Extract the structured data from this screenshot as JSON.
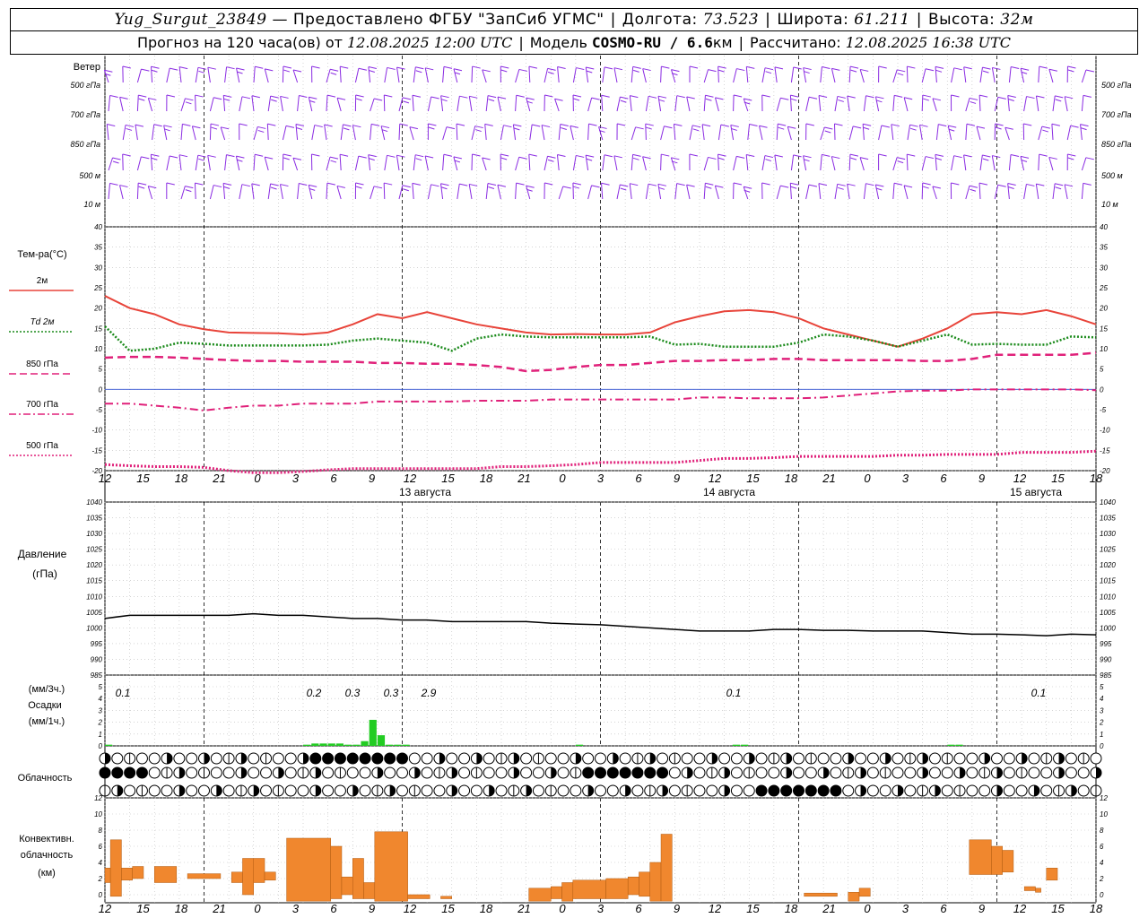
{
  "header": {
    "station": "Yug_Surgut_23849",
    "provider": "— Предоставлено ФГБУ \"ЗапСиб УГМС\"",
    "lon_label": "Долгота:",
    "lon": "73.523",
    "lat_label": "Широта:",
    "lat": "61.211",
    "alt_label": "Высота:",
    "alt": "32м",
    "forecast_prefix": "Прогноз на 120 часа(ов) от",
    "forecast_time": "12.08.2025 12:00 UTC",
    "model_label": "Модель",
    "model": "COSMO-RU / 6.6",
    "model_unit": "км",
    "computed_label": "Рассчитано:",
    "computed_time": "12.08.2025 16:38 UTC"
  },
  "colors": {
    "wind": "#8a2be2",
    "t2m": "#e8443a",
    "td2m": "#1a8a1a",
    "t850": "#e0217a",
    "t700": "#e0217a",
    "t500": "#e0217a",
    "precip": "#22cc22",
    "convective": "#f0872e"
  },
  "wind_panel": {
    "title": "Ветер",
    "levels": [
      "500 гПа",
      "700 гПа",
      "850 гПа",
      "500 м",
      "10 м"
    ]
  },
  "temp_panel": {
    "title": "Тем-ра(°С)",
    "legend": [
      {
        "label": "2м",
        "style": "solid",
        "key": "t2m"
      },
      {
        "label": "Td 2м",
        "style": "dotted",
        "key": "td2m"
      },
      {
        "label": "850 гПа",
        "style": "dash",
        "key": "t850"
      },
      {
        "label": "700 гПа",
        "style": "dashdot",
        "key": "t700"
      },
      {
        "label": "500 гПа",
        "style": "dotted",
        "key": "t500"
      }
    ],
    "ticks": [
      "40",
      "35",
      "30",
      "25",
      "20",
      "15",
      "10",
      "5",
      "0",
      "-5",
      "-10",
      "-15",
      "-20"
    ]
  },
  "x_axis": {
    "hour_labels": [
      "12",
      "15",
      "18",
      "21",
      "0",
      "3",
      "6",
      "9",
      "12",
      "15",
      "18",
      "21",
      "0",
      "3",
      "6",
      "9",
      "12",
      "15",
      "18",
      "21",
      "0",
      "3",
      "6",
      "9",
      "12",
      "15",
      "18"
    ],
    "day_labels": [
      "13 августа",
      "14 августа",
      "15 августа"
    ]
  },
  "pressure_panel": {
    "title": "Давление",
    "unit": "(гПа)",
    "ticks": [
      "1040",
      "1035",
      "1030",
      "1025",
      "1020",
      "1015",
      "1010",
      "1005",
      "1000",
      "995",
      "990",
      "985"
    ]
  },
  "precip_panel": {
    "unit_top": "(мм/3ч.)",
    "title": "Осадки",
    "unit_bottom": "(мм/1ч.)",
    "ticks": [
      "5",
      "4",
      "3",
      "2",
      "1",
      "0"
    ],
    "totals": [
      "0.1",
      "0.2",
      "0.3",
      "0.3",
      "2.9",
      "0.1",
      "0.1"
    ]
  },
  "cloud_panel": {
    "title": "Облачность"
  },
  "conv_panel": {
    "title1": "Конвективн.",
    "title2": "облачность",
    "unit": "(км)",
    "ticks": [
      "12",
      "10",
      "8",
      "6",
      "4",
      "2",
      "0"
    ]
  },
  "chart_data": [
    {
      "type": "line",
      "name": "temperature",
      "ylabel": "Тем-ра(°С)",
      "ylim": [
        -20,
        40
      ],
      "x_hours_from_start": [
        0,
        3,
        6,
        9,
        12,
        15,
        18,
        21,
        24,
        27,
        30,
        33,
        36,
        39,
        42,
        45,
        48,
        51,
        54,
        57,
        60,
        63,
        66,
        69,
        72,
        75,
        78,
        81,
        84,
        87,
        90,
        93,
        96,
        99,
        102,
        105,
        108,
        111,
        114,
        117,
        120
      ],
      "series": [
        {
          "name": "2м",
          "values": [
            23,
            20,
            18.5,
            16,
            14.8,
            14,
            13.9,
            13.8,
            13.5,
            14,
            16,
            18.5,
            17.5,
            19,
            17.5,
            16,
            15,
            14,
            13.5,
            13.6,
            13.5,
            13.5,
            14,
            16.5,
            18,
            19.2,
            19.5,
            19,
            17.5,
            15,
            13.5,
            12,
            10.5,
            12.5,
            15,
            18.5,
            19,
            18.5,
            19.5,
            18,
            16
          ]
        },
        {
          "name": "Td 2м",
          "values": [
            15.5,
            9.5,
            10,
            11.5,
            11.2,
            10.8,
            10.8,
            10.8,
            10.8,
            11,
            12,
            12.5,
            12,
            11.5,
            9.5,
            12.5,
            13.5,
            13,
            12.8,
            12.8,
            12.8,
            12.8,
            13,
            11,
            11.2,
            10.5,
            10.5,
            10.5,
            11.5,
            13.5,
            13,
            12,
            10.5,
            12,
            13.5,
            11,
            11.2,
            11,
            11,
            13,
            12.8
          ]
        },
        {
          "name": "850 гПа",
          "values": [
            7.8,
            8,
            8,
            7.8,
            7.5,
            7.2,
            7,
            7,
            6.8,
            6.8,
            6.8,
            6.5,
            6.5,
            6.3,
            6.3,
            6,
            5.5,
            4.5,
            4.8,
            5.5,
            6,
            6,
            6.5,
            7,
            7,
            7.2,
            7.2,
            7.5,
            7.5,
            7.2,
            7.2,
            7.2,
            7.2,
            7,
            7,
            7.5,
            8.5,
            8.5,
            8.5,
            8.5,
            9
          ]
        },
        {
          "name": "700 гПа",
          "values": [
            -3.5,
            -3.5,
            -4,
            -4.5,
            -5.2,
            -4.5,
            -4,
            -4,
            -3.5,
            -3.5,
            -3.5,
            -3,
            -3,
            -3,
            -3,
            -2.8,
            -2.8,
            -2.8,
            -2.5,
            -2.5,
            -2.5,
            -2.5,
            -2.5,
            -2.5,
            -2,
            -2,
            -2.2,
            -2.2,
            -2.2,
            -2,
            -1.5,
            -1,
            -0.5,
            -0.3,
            -0.3,
            0,
            0,
            0,
            0,
            0,
            -0.2
          ]
        },
        {
          "name": "500 гПа",
          "values": [
            -18.5,
            -18.8,
            -19,
            -19,
            -19.2,
            -20,
            -20.5,
            -20.5,
            -20.2,
            -19.8,
            -19.5,
            -19.5,
            -19.5,
            -19.5,
            -19.5,
            -19.5,
            -19,
            -19,
            -18.8,
            -18.5,
            -18,
            -18,
            -18,
            -18,
            -17.5,
            -17,
            -17,
            -16.8,
            -16.5,
            -16.5,
            -16.5,
            -16.5,
            -16.2,
            -16.2,
            -16,
            -16,
            -16,
            -15.5,
            -15.5,
            -15.5,
            -15.2
          ]
        }
      ]
    },
    {
      "type": "line",
      "name": "pressure",
      "ylabel": "Давление (гПа)",
      "ylim": [
        985,
        1040
      ],
      "x_hours_from_start": [
        0,
        3,
        6,
        9,
        12,
        15,
        18,
        21,
        24,
        27,
        30,
        33,
        36,
        39,
        42,
        45,
        48,
        51,
        54,
        57,
        60,
        63,
        66,
        69,
        72,
        75,
        78,
        81,
        84,
        87,
        90,
        93,
        96,
        99,
        102,
        105,
        108,
        111,
        114,
        117,
        120
      ],
      "values": [
        1003,
        1004,
        1004,
        1004,
        1004,
        1004,
        1004.5,
        1004,
        1004,
        1003.5,
        1003,
        1003,
        1002.5,
        1002.5,
        1002,
        1002,
        1002,
        1002,
        1001.5,
        1001.2,
        1001,
        1000.5,
        1000,
        999.5,
        999,
        999,
        999,
        999.5,
        999.5,
        999.2,
        999.2,
        999,
        999,
        999,
        998.5,
        998,
        998,
        997.8,
        997.5,
        998,
        997.8
      ]
    },
    {
      "type": "bar",
      "name": "precipitation",
      "ylabel": "Осадки (мм/1ч.)",
      "ylim": [
        0,
        5
      ],
      "x_hours_from_start": [
        0,
        24,
        25,
        26,
        27,
        28,
        29,
        30,
        31,
        32,
        33,
        34,
        35,
        36,
        57,
        76,
        77,
        102,
        103
      ],
      "values": [
        0.1,
        0.1,
        0.2,
        0.2,
        0.2,
        0.2,
        0.1,
        0.1,
        0.4,
        2.2,
        0.9,
        0.1,
        0.1,
        0.1,
        0.1,
        0.1,
        0.1,
        0.1,
        0.1
      ],
      "labels_3h": [
        "0.1",
        "0.2",
        "0.3",
        "0.3",
        "2.9",
        "0.1",
        "0.1"
      ]
    },
    {
      "type": "bar",
      "name": "convective_cloud",
      "ylabel": "Конвективн. облачность (км)",
      "ylim": [
        0,
        13
      ],
      "segments": [
        {
          "x0": 0,
          "x1": 0.5,
          "bottom": 2.5,
          "top": 4.3
        },
        {
          "x0": 0.5,
          "x1": 1.5,
          "bottom": 0.8,
          "top": 7.8
        },
        {
          "x0": 1.5,
          "x1": 2.5,
          "bottom": 2.8,
          "top": 4.3
        },
        {
          "x0": 2.5,
          "x1": 3.5,
          "bottom": 3.0,
          "top": 4.5
        },
        {
          "x0": 4.5,
          "x1": 6.5,
          "bottom": 2.5,
          "top": 4.5
        },
        {
          "x0": 7.5,
          "x1": 10.5,
          "bottom": 3.0,
          "top": 3.6
        },
        {
          "x0": 11.5,
          "x1": 12.5,
          "bottom": 2.5,
          "top": 3.8
        },
        {
          "x0": 12.5,
          "x1": 13.5,
          "bottom": 1.0,
          "top": 5.5
        },
        {
          "x0": 13.5,
          "x1": 14.5,
          "bottom": 2.5,
          "top": 5.5
        },
        {
          "x0": 14.5,
          "x1": 15.5,
          "bottom": 2.8,
          "top": 3.8
        },
        {
          "x0": 16.5,
          "x1": 20.5,
          "bottom": 0.2,
          "top": 8.0
        },
        {
          "x0": 20.5,
          "x1": 21.5,
          "bottom": 0.5,
          "top": 7.0
        },
        {
          "x0": 21.5,
          "x1": 22.5,
          "bottom": 1.0,
          "top": 3.2
        },
        {
          "x0": 22.5,
          "x1": 23.5,
          "bottom": 0.5,
          "top": 5.5
        },
        {
          "x0": 23.5,
          "x1": 24.5,
          "bottom": 0.5,
          "top": 2.5
        },
        {
          "x0": 24.5,
          "x1": 27.5,
          "bottom": 0.2,
          "top": 8.8
        },
        {
          "x0": 27.5,
          "x1": 29.5,
          "bottom": 0.5,
          "top": 1.0
        },
        {
          "x0": 30.5,
          "x1": 31.5,
          "bottom": 0.5,
          "top": 0.8
        },
        {
          "x0": 38.5,
          "x1": 40.5,
          "bottom": 0.2,
          "top": 1.8
        },
        {
          "x0": 40.5,
          "x1": 41.5,
          "bottom": 0.5,
          "top": 2.0
        },
        {
          "x0": 41.5,
          "x1": 42.5,
          "bottom": 0.2,
          "top": 2.5
        },
        {
          "x0": 42.5,
          "x1": 45.5,
          "bottom": 0.5,
          "top": 2.8
        },
        {
          "x0": 45.5,
          "x1": 47.5,
          "bottom": 0.5,
          "top": 3.0
        },
        {
          "x0": 47.5,
          "x1": 48.5,
          "bottom": 1.0,
          "top": 3.2
        },
        {
          "x0": 48.5,
          "x1": 49.5,
          "bottom": 0.8,
          "top": 3.8
        },
        {
          "x0": 49.5,
          "x1": 50.5,
          "bottom": 0.2,
          "top": 5.0
        },
        {
          "x0": 50.5,
          "x1": 51.5,
          "bottom": 0.2,
          "top": 8.5
        },
        {
          "x0": 63.5,
          "x1": 66.5,
          "bottom": 0.8,
          "top": 1.2
        },
        {
          "x0": 67.5,
          "x1": 68.5,
          "bottom": 0.2,
          "top": 1.3
        },
        {
          "x0": 68.5,
          "x1": 69.5,
          "bottom": 0.8,
          "top": 1.8
        },
        {
          "x0": 78.5,
          "x1": 80.5,
          "bottom": 3.5,
          "top": 7.8
        },
        {
          "x0": 80.5,
          "x1": 81.5,
          "bottom": 3.5,
          "top": 7.0
        },
        {
          "x0": 81.5,
          "x1": 82.5,
          "bottom": 3.8,
          "top": 6.5
        },
        {
          "x0": 83.5,
          "x1": 84.5,
          "bottom": 1.5,
          "top": 2.0
        },
        {
          "x0": 84.5,
          "x1": 85,
          "bottom": 1.3,
          "top": 1.8
        },
        {
          "x0": 85.5,
          "x1": 86.5,
          "bottom": 2.8,
          "top": 4.3
        }
      ]
    }
  ]
}
